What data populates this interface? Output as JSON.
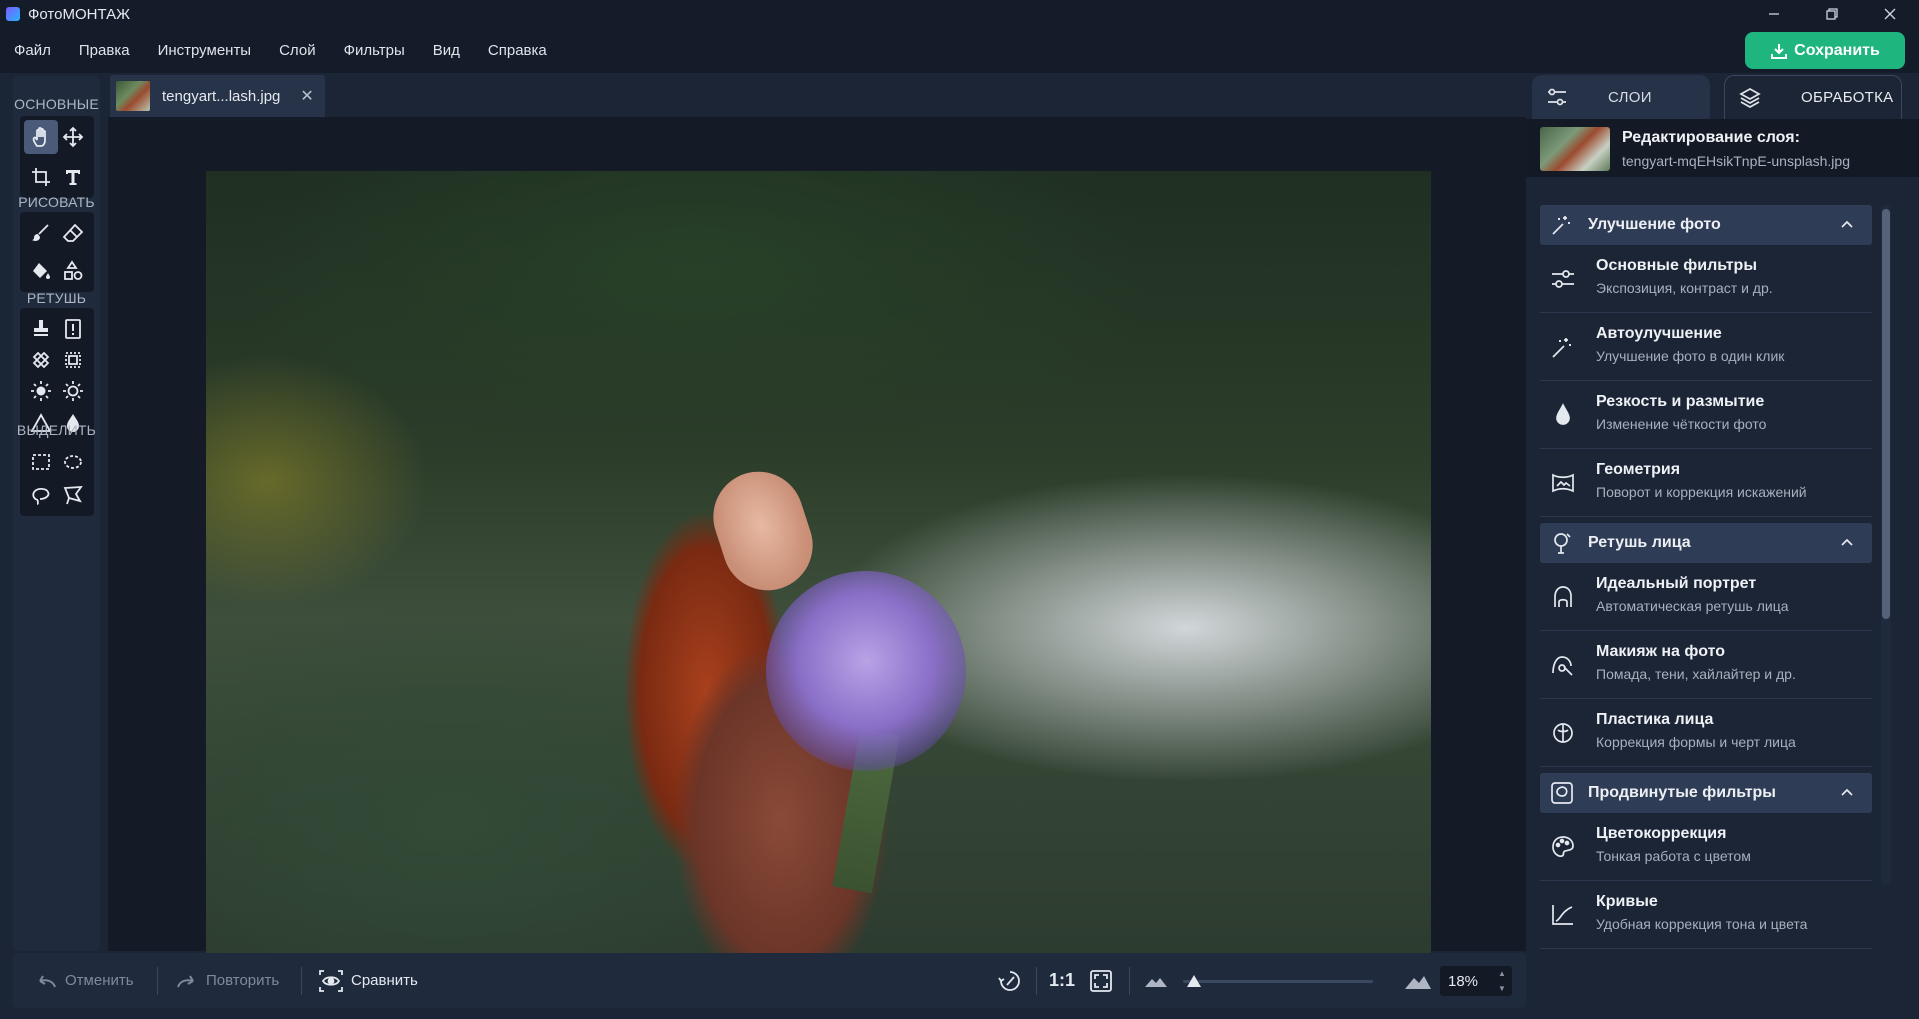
{
  "app": {
    "title": "ФотоМОНТАЖ"
  },
  "menu": [
    "Файл",
    "Правка",
    "Инструменты",
    "Слой",
    "Фильтры",
    "Вид",
    "Справка"
  ],
  "save_button": "Сохранить",
  "tool_groups": {
    "basic": "ОСНОВНЫЕ",
    "draw": "РИСОВАТЬ",
    "retouch": "РЕТУШЬ",
    "select": "ВЫДЕЛИТЬ"
  },
  "document_tab": {
    "name": "tengyart...lash.jpg",
    "close": "✕"
  },
  "bottom": {
    "undo": "Отменить",
    "redo": "Повторить",
    "compare": "Сравнить",
    "actual_size": "1:1",
    "zoom_value": "18%",
    "zoom_level": 0.18
  },
  "right_panel": {
    "tabs": {
      "layers": "СЛОИ",
      "processing": "ОБРАБОТКА"
    },
    "layer_editing_title": "Редактирование слоя:",
    "layer_file": "tengyart-mqEHsikTnpE-unsplash.jpg",
    "sections": [
      {
        "title": "Улучшение фото",
        "icon": "magic-wand-icon",
        "items": [
          {
            "title": "Основные фильтры",
            "subtitle": "Экспозиция, контраст и др.",
            "icon": "sliders-icon"
          },
          {
            "title": "Автоулучшение",
            "subtitle": "Улучшение фото в один клик",
            "icon": "magic-wand-icon"
          },
          {
            "title": "Резкость и размытие",
            "subtitle": "Изменение чёткости фото",
            "icon": "drop-icon"
          },
          {
            "title": "Геометрия",
            "subtitle": "Поворот и коррекция искажений",
            "icon": "geometry-icon"
          }
        ]
      },
      {
        "title": "Ретушь лица",
        "icon": "face-retouch-icon",
        "items": [
          {
            "title": "Идеальный портрет",
            "subtitle": "Автоматическая ретушь лица",
            "icon": "portrait-icon"
          },
          {
            "title": "Макияж на фото",
            "subtitle": "Помада, тени, хайлайтер и др.",
            "icon": "makeup-icon"
          },
          {
            "title": "Пластика лица",
            "subtitle": "Коррекция формы и черт лица",
            "icon": "face-shape-icon"
          }
        ]
      },
      {
        "title": "Продвинутые фильтры",
        "icon": "advanced-filters-icon",
        "items": [
          {
            "title": "Цветокоррекция",
            "subtitle": "Тонкая работа с цветом",
            "icon": "palette-icon"
          },
          {
            "title": "Кривые",
            "subtitle": "Удобная коррекция тона и цвета",
            "icon": "curves-icon"
          }
        ]
      }
    ]
  },
  "colors": {
    "accent_green": "#1fb57e",
    "panel": "#1f2a3c",
    "background": "#1c2535"
  }
}
